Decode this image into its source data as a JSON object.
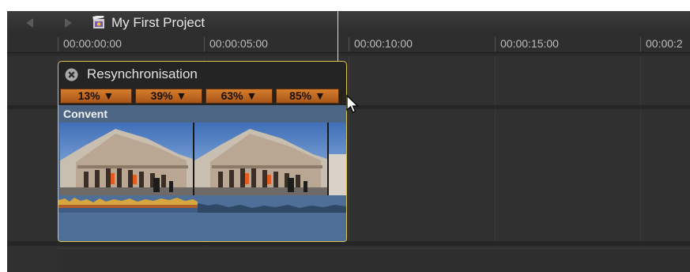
{
  "titlebar": {
    "title": "My First Project",
    "back_icon": "back-arrow-icon",
    "forward_icon": "forward-arrow-icon",
    "project_icon": "clapper-project-icon"
  },
  "ruler": {
    "ticks": [
      "00:00:00:00",
      "00:00:05:00",
      "00:00:10:00",
      "00:00:15:00",
      "00:00:2"
    ]
  },
  "retime_editor": {
    "title": "Resynchronisation",
    "close_icon": "close-circle-icon",
    "segments": [
      {
        "label": "13% ▼"
      },
      {
        "label": "39% ▼"
      },
      {
        "label": "63% ▼"
      },
      {
        "label": "85% ▼"
      }
    ],
    "accent_color": "#d67d2c",
    "selection_color": "#d9c64a"
  },
  "clip": {
    "name": "Convent",
    "thumbnail_icon": "building-photo-thumbnail",
    "audio_icon": "audio-waveform"
  },
  "cursor": {
    "icon": "arrow-pointer-icon"
  }
}
